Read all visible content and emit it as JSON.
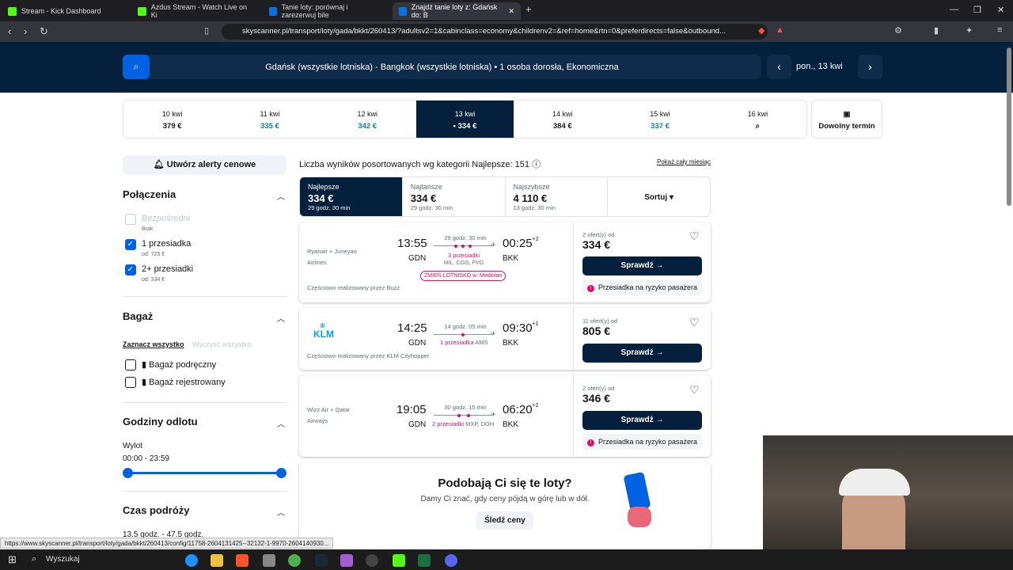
{
  "tabs": [
    {
      "label": "Stream - Kick Dashboard",
      "fav": "#53fc18"
    },
    {
      "label": "Azdus Stream - Watch Live on Ki",
      "fav": "#53fc18"
    },
    {
      "label": "Tanie loty: porównaj i zarezerwuj bile",
      "fav": "#0770e3"
    },
    {
      "label": "Znajdź tanie loty z: Gdańsk do: B",
      "fav": "#0770e3"
    }
  ],
  "url": "skyscanner.pl/transport/loty/gada/bkkt/260413/?adultsv2=1&cabinclass=economy&childrenv2=&ref=home&rtn=0&preferdirects=false&outbound...",
  "search": {
    "summary": "Gdańsk (wszystkie lotniska) - Bangkok (wszystkie lotniska)  •  1 osoba dorosła, Ekonomiczna",
    "date": "pon., 13 kwi"
  },
  "dates": [
    {
      "d": "10 kwi",
      "p": "379 €",
      "green": false
    },
    {
      "d": "11 kwi",
      "p": "335 €",
      "green": true
    },
    {
      "d": "12 kwi",
      "p": "342 €",
      "green": true
    },
    {
      "d": "13 kwi",
      "p": "• 334 €",
      "green": false,
      "sel": true
    },
    {
      "d": "14 kwi",
      "p": "384 €",
      "green": false
    },
    {
      "d": "15 kwi",
      "p": "337 €",
      "green": true
    },
    {
      "d": "16 kwi",
      "p": "🔍",
      "green": false
    }
  ],
  "anydate": "Dowolny termin",
  "sidebar": {
    "alert": "Utwórz alerty cenowe",
    "connections_title": "Połączenia",
    "direct": "Bezpośredni",
    "direct_sub": "Brak",
    "one_stop": "1 przesiadka",
    "one_stop_sub": "od: 725 €",
    "two_stop": "2+ przesiadki",
    "two_stop_sub": "od: 334 €",
    "baggage_title": "Bagaż",
    "select_all": "Zaznacz wszystko",
    "clear_all": "Wyczyść wszystko",
    "carry_on": "Bagaż podręczny",
    "checked": "Bagaż rejestrowany",
    "times_title": "Godziny odlotu",
    "departure": "Wylot",
    "range": "00:00 - 23:59",
    "duration_title": "Czas podróży",
    "duration_range": "13.5 godz. - 47.5 godz."
  },
  "results": {
    "count": "Liczba wyników posortowanych wg kategorii Najlepsze: 151",
    "show_month": "Pokaż cały miesiąc",
    "sort": [
      {
        "label": "Najlepsze",
        "price": "334 €",
        "dur": "29 godz. 30 min"
      },
      {
        "label": "Najtańsze",
        "price": "334 €",
        "dur": "29 godz. 30 min"
      },
      {
        "label": "Najszybsze",
        "price": "4 110 €",
        "dur": "13 godz. 30 min"
      }
    ],
    "sort_btn": "Sortuj"
  },
  "flights": [
    {
      "airline": "Ryanair + Juneyao Airlines",
      "dep": "13:55",
      "dep_ap": "GDN",
      "arr": "00:25",
      "arr_plus": "+2",
      "arr_ap": "BKK",
      "dur": "29 godz. 30 min",
      "stops": "3 przesiadki",
      "via": "MIL, CGO, PVG",
      "tag": "ZMIEŃ LOTNISKO w: Mediolan",
      "partial": "Częściowo realizowany przez Buzz",
      "offers": "2 ofert(y) od",
      "price": "334 €",
      "btn": "Sprawdź →",
      "risk": "Przesiadka na ryzyko pasażera"
    },
    {
      "airline": "KLM",
      "dep": "14:25",
      "dep_ap": "GDN",
      "arr": "09:30",
      "arr_plus": "+1",
      "arr_ap": "BKK",
      "dur": "14 godz. 05 min",
      "stops": "1 przesiadka",
      "via": "AMS",
      "partial": "Częściowo realizowany przez KLM Cityhopper",
      "offers": "11 ofert(y) od",
      "price": "805 €",
      "btn": "Sprawdź →"
    },
    {
      "airline": "Wizz Air + Qatar Airways",
      "dep": "19:05",
      "dep_ap": "GDN",
      "arr": "06:20",
      "arr_plus": "+2",
      "arr_ap": "BKK",
      "dur": "30 godz. 15 min",
      "stops": "2 przesiadki",
      "via": "MXP, DOH",
      "offers": "2 ofert(y) od",
      "price": "346 €",
      "btn": "Sprawdź →",
      "risk": "Przesiadka na ryzyko pasażera"
    }
  ],
  "promo": {
    "title": "Podobają Ci się te loty?",
    "text": "Damy Ci znać, gdy ceny pójdą w górę lub w dół.",
    "btn": "Śledź ceny"
  },
  "status_url": "https://www.skyscanner.pl/transport/loty/gada/bkkt/260413/config/11758-2604131425--32132-1-9970-2604140930...",
  "taskbar": {
    "search": "Wyszukaj"
  }
}
